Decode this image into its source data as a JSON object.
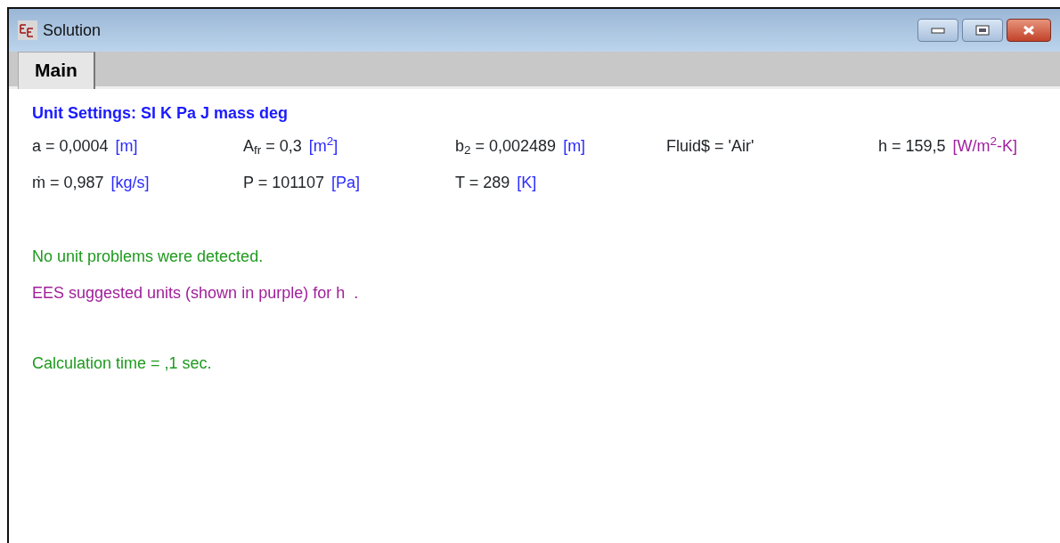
{
  "window": {
    "title": "Solution"
  },
  "tabs": [
    {
      "label": "Main",
      "selected": true
    }
  ],
  "unit_settings": "Unit Settings: SI K Pa J mass deg",
  "variables": [
    {
      "equation": "a = 0,0004",
      "unit": "[m]",
      "suggested": false
    },
    {
      "equation": "A$_{fr}$ = 0,3",
      "unit": "[m$^{2}$]",
      "suggested": false
    },
    {
      "equation": "b$_{2}$ = 0,002489",
      "unit": "[m]",
      "suggested": false
    },
    {
      "equation": "Fluid$ = 'Air'"
    },
    {
      "equation": "h = 159,5",
      "unit": "[W/m$^{2}$-K]",
      "suggested": true
    },
    {
      "equation": "ṁ = 0,987",
      "unit": "[kg/s]",
      "suggested": false
    },
    {
      "equation": "P  = 101107",
      "unit": "[Pa]",
      "suggested": false
    },
    {
      "equation": "T = 289",
      "unit": "[K]",
      "suggested": false
    }
  ],
  "messages": [
    {
      "kind": "status",
      "text": "No unit problems were detected."
    },
    {
      "kind": "suggestion",
      "text": "EES suggested units (shown in purple) for h  ."
    },
    {
      "kind": "timing",
      "text": "Calculation time = ,1 sec."
    }
  ]
}
